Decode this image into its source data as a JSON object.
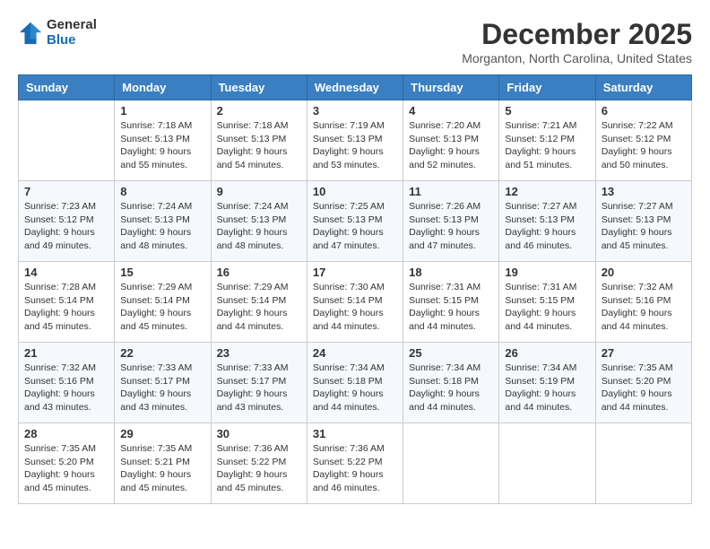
{
  "header": {
    "logo_general": "General",
    "logo_blue": "Blue",
    "month_title": "December 2025",
    "location": "Morganton, North Carolina, United States"
  },
  "days_of_week": [
    "Sunday",
    "Monday",
    "Tuesday",
    "Wednesday",
    "Thursday",
    "Friday",
    "Saturday"
  ],
  "weeks": [
    [
      {
        "day": "",
        "info": ""
      },
      {
        "day": "1",
        "info": "Sunrise: 7:18 AM\nSunset: 5:13 PM\nDaylight: 9 hours\nand 55 minutes."
      },
      {
        "day": "2",
        "info": "Sunrise: 7:18 AM\nSunset: 5:13 PM\nDaylight: 9 hours\nand 54 minutes."
      },
      {
        "day": "3",
        "info": "Sunrise: 7:19 AM\nSunset: 5:13 PM\nDaylight: 9 hours\nand 53 minutes."
      },
      {
        "day": "4",
        "info": "Sunrise: 7:20 AM\nSunset: 5:13 PM\nDaylight: 9 hours\nand 52 minutes."
      },
      {
        "day": "5",
        "info": "Sunrise: 7:21 AM\nSunset: 5:12 PM\nDaylight: 9 hours\nand 51 minutes."
      },
      {
        "day": "6",
        "info": "Sunrise: 7:22 AM\nSunset: 5:12 PM\nDaylight: 9 hours\nand 50 minutes."
      }
    ],
    [
      {
        "day": "7",
        "info": "Sunrise: 7:23 AM\nSunset: 5:12 PM\nDaylight: 9 hours\nand 49 minutes."
      },
      {
        "day": "8",
        "info": "Sunrise: 7:24 AM\nSunset: 5:13 PM\nDaylight: 9 hours\nand 48 minutes."
      },
      {
        "day": "9",
        "info": "Sunrise: 7:24 AM\nSunset: 5:13 PM\nDaylight: 9 hours\nand 48 minutes."
      },
      {
        "day": "10",
        "info": "Sunrise: 7:25 AM\nSunset: 5:13 PM\nDaylight: 9 hours\nand 47 minutes."
      },
      {
        "day": "11",
        "info": "Sunrise: 7:26 AM\nSunset: 5:13 PM\nDaylight: 9 hours\nand 47 minutes."
      },
      {
        "day": "12",
        "info": "Sunrise: 7:27 AM\nSunset: 5:13 PM\nDaylight: 9 hours\nand 46 minutes."
      },
      {
        "day": "13",
        "info": "Sunrise: 7:27 AM\nSunset: 5:13 PM\nDaylight: 9 hours\nand 45 minutes."
      }
    ],
    [
      {
        "day": "14",
        "info": "Sunrise: 7:28 AM\nSunset: 5:14 PM\nDaylight: 9 hours\nand 45 minutes."
      },
      {
        "day": "15",
        "info": "Sunrise: 7:29 AM\nSunset: 5:14 PM\nDaylight: 9 hours\nand 45 minutes."
      },
      {
        "day": "16",
        "info": "Sunrise: 7:29 AM\nSunset: 5:14 PM\nDaylight: 9 hours\nand 44 minutes."
      },
      {
        "day": "17",
        "info": "Sunrise: 7:30 AM\nSunset: 5:14 PM\nDaylight: 9 hours\nand 44 minutes."
      },
      {
        "day": "18",
        "info": "Sunrise: 7:31 AM\nSunset: 5:15 PM\nDaylight: 9 hours\nand 44 minutes."
      },
      {
        "day": "19",
        "info": "Sunrise: 7:31 AM\nSunset: 5:15 PM\nDaylight: 9 hours\nand 44 minutes."
      },
      {
        "day": "20",
        "info": "Sunrise: 7:32 AM\nSunset: 5:16 PM\nDaylight: 9 hours\nand 44 minutes."
      }
    ],
    [
      {
        "day": "21",
        "info": "Sunrise: 7:32 AM\nSunset: 5:16 PM\nDaylight: 9 hours\nand 43 minutes."
      },
      {
        "day": "22",
        "info": "Sunrise: 7:33 AM\nSunset: 5:17 PM\nDaylight: 9 hours\nand 43 minutes."
      },
      {
        "day": "23",
        "info": "Sunrise: 7:33 AM\nSunset: 5:17 PM\nDaylight: 9 hours\nand 43 minutes."
      },
      {
        "day": "24",
        "info": "Sunrise: 7:34 AM\nSunset: 5:18 PM\nDaylight: 9 hours\nand 44 minutes."
      },
      {
        "day": "25",
        "info": "Sunrise: 7:34 AM\nSunset: 5:18 PM\nDaylight: 9 hours\nand 44 minutes."
      },
      {
        "day": "26",
        "info": "Sunrise: 7:34 AM\nSunset: 5:19 PM\nDaylight: 9 hours\nand 44 minutes."
      },
      {
        "day": "27",
        "info": "Sunrise: 7:35 AM\nSunset: 5:20 PM\nDaylight: 9 hours\nand 44 minutes."
      }
    ],
    [
      {
        "day": "28",
        "info": "Sunrise: 7:35 AM\nSunset: 5:20 PM\nDaylight: 9 hours\nand 45 minutes."
      },
      {
        "day": "29",
        "info": "Sunrise: 7:35 AM\nSunset: 5:21 PM\nDaylight: 9 hours\nand 45 minutes."
      },
      {
        "day": "30",
        "info": "Sunrise: 7:36 AM\nSunset: 5:22 PM\nDaylight: 9 hours\nand 45 minutes."
      },
      {
        "day": "31",
        "info": "Sunrise: 7:36 AM\nSunset: 5:22 PM\nDaylight: 9 hours\nand 46 minutes."
      },
      {
        "day": "",
        "info": ""
      },
      {
        "day": "",
        "info": ""
      },
      {
        "day": "",
        "info": ""
      }
    ]
  ]
}
